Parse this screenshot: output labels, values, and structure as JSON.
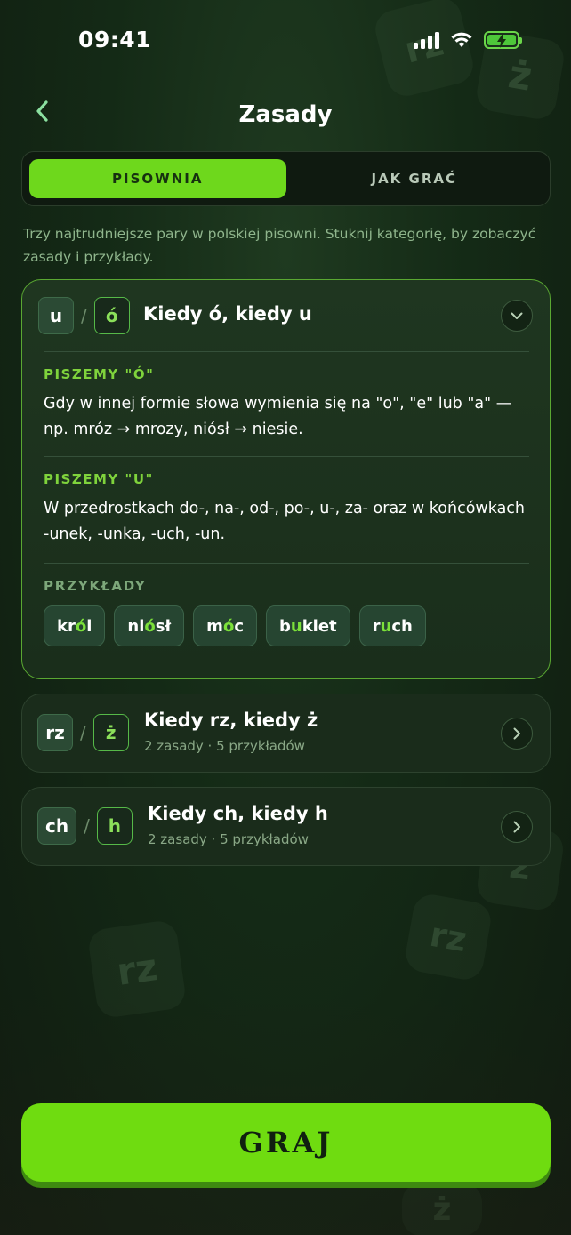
{
  "status": {
    "time": "09:41"
  },
  "header": {
    "title": "Zasady"
  },
  "tabs": [
    {
      "label": "PISOWNIA",
      "active": true
    },
    {
      "label": "JAK GRAĆ",
      "active": false
    }
  ],
  "intro": "Trzy najtrudniejsze pary w polskiej pisowni. Stuknij kategorię, by zobaczyć zasady i przykłady.",
  "categories": [
    {
      "letter_a": "u",
      "letter_b": "ó",
      "title": "Kiedy ó, kiedy u",
      "expanded": true,
      "rules": [
        {
          "label": "PISZEMY \"Ó\"",
          "text": "Gdy w innej formie słowa wymienia się na \"o\", \"e\" lub \"a\" — np. mróz → mrozy, niósł → niesie."
        },
        {
          "label": "PISZEMY \"U\"",
          "text": "W przedrostkach do-, na-, od-, po-, u-, za- oraz w końcówkach -unek, -unka, -uch, -un."
        }
      ],
      "examples_label": "PRZYKŁADY",
      "examples": [
        {
          "pre": "kr",
          "hl": "ó",
          "post": "l"
        },
        {
          "pre": "ni",
          "hl": "ó",
          "post": "sł"
        },
        {
          "pre": "m",
          "hl": "ó",
          "post": "c"
        },
        {
          "pre": "b",
          "hl": "u",
          "post": "kiet"
        },
        {
          "pre": "r",
          "hl": "u",
          "post": "ch"
        }
      ]
    },
    {
      "letter_a": "rz",
      "letter_b": "ż",
      "title": "Kiedy rz, kiedy ż",
      "subtitle": "2 zasady · 5 przykładów",
      "expanded": false
    },
    {
      "letter_a": "ch",
      "letter_b": "h",
      "title": "Kiedy ch, kiedy h",
      "subtitle": "2 zasady · 5 przykładów",
      "expanded": false
    }
  ],
  "background_tiles": [
    "rz",
    "ż",
    "ż",
    "rz",
    "rz",
    "ż"
  ],
  "play_button": {
    "label": "GRAJ"
  },
  "colors": {
    "accent": "#6ed81c",
    "background": "#142a16",
    "text_muted": "#8fb58c"
  }
}
